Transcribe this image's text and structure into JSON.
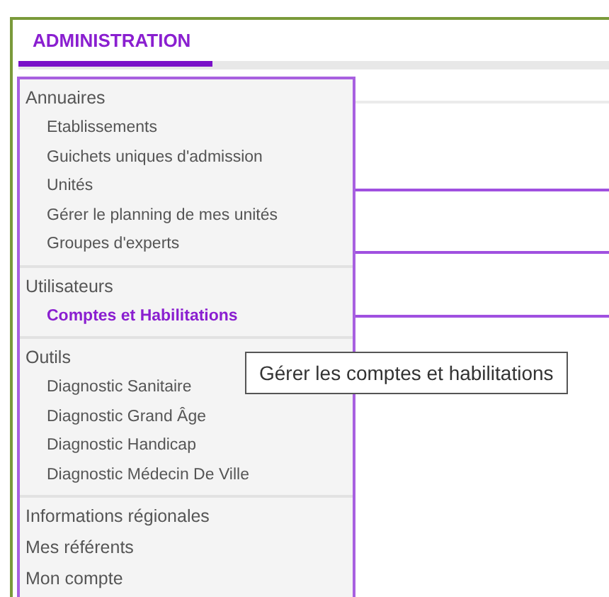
{
  "header": {
    "title": "ADMINISTRATION"
  },
  "menu": {
    "groups": [
      {
        "items": [
          {
            "label": "Annuaires",
            "kind": "heading",
            "selected": false
          },
          {
            "label": "Etablissements",
            "kind": "link",
            "selected": false
          },
          {
            "label": "Guichets uniques d'admission",
            "kind": "link",
            "selected": false
          },
          {
            "label": "Unités",
            "kind": "link",
            "selected": false
          },
          {
            "label": "Gérer le planning de mes unités",
            "kind": "link",
            "selected": false
          },
          {
            "label": "Groupes d'experts",
            "kind": "link",
            "selected": false
          }
        ]
      },
      {
        "items": [
          {
            "label": "Utilisateurs",
            "kind": "heading",
            "selected": false
          },
          {
            "label": "Comptes et Habilitations",
            "kind": "link",
            "selected": true
          }
        ]
      },
      {
        "items": [
          {
            "label": "Outils",
            "kind": "heading",
            "selected": false
          },
          {
            "label": "Diagnostic Sanitaire",
            "kind": "link",
            "selected": false
          },
          {
            "label": "Diagnostic Grand Âge",
            "kind": "link",
            "selected": false
          },
          {
            "label": "Diagnostic Handicap",
            "kind": "link",
            "selected": false
          },
          {
            "label": "Diagnostic Médecin De Ville",
            "kind": "link",
            "selected": false
          }
        ]
      },
      {
        "items": [
          {
            "label": "Informations régionales",
            "kind": "heading",
            "selected": false
          },
          {
            "label": "Mes référents",
            "kind": "heading",
            "selected": false
          },
          {
            "label": "Mon compte",
            "kind": "heading",
            "selected": false
          }
        ]
      }
    ]
  },
  "tooltip": {
    "text": "Gérer les comptes et habilitations"
  }
}
